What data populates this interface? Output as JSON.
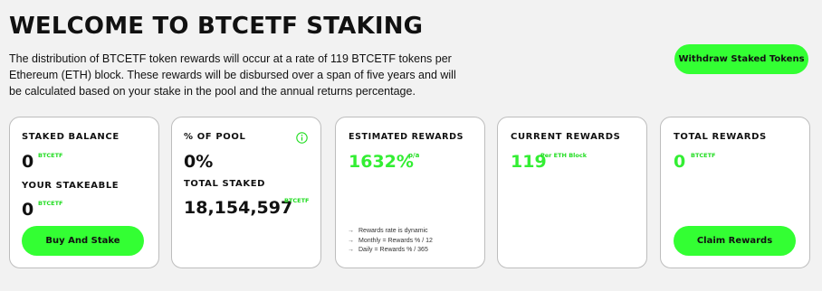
{
  "header": {
    "title": "WELCOME TO BTCETF STAKING",
    "intro": "The distribution of BTCETF token rewards will occur at a rate of 119 BTCETF tokens per Ethereum (ETH) block. These rewards will be disbursed over a span of five years and will be calculated based on your stake in the pool and the annual returns percentage.",
    "withdraw_label": "Withdraw Staked Tokens"
  },
  "cards": {
    "staked": {
      "title": "STAKED BALANCE",
      "value": "0",
      "unit": "BTCETF",
      "stakeable_title": "YOUR STAKEABLE",
      "stakeable_value": "0",
      "stakeable_unit": "BTCETF",
      "button": "Buy And Stake"
    },
    "pool": {
      "title": "% OF POOL",
      "value": "0%",
      "info_icon": "info-circle-icon",
      "total_title": "TOTAL STAKED",
      "total_value": "18,154,597",
      "total_unit": "BTCETF"
    },
    "estimated": {
      "title": "ESTIMATED REWARDS",
      "value": "1632%",
      "suffix": "p/a",
      "notes": [
        "Rewards rate is dynamic",
        "Monthly = Rewards % / 12",
        "Daily = Rewards % / 365"
      ]
    },
    "current": {
      "title": "CURRENT REWARDS",
      "value": "119",
      "unit": "Per ETH Block"
    },
    "total": {
      "title": "TOTAL REWARDS",
      "value": "0",
      "unit": "BTCETF",
      "button": "Claim Rewards"
    }
  },
  "colors": {
    "accent": "#33ff33",
    "accent_text": "#22dd22",
    "background": "#f2f2f2",
    "card_border": "#bdbdbd"
  }
}
